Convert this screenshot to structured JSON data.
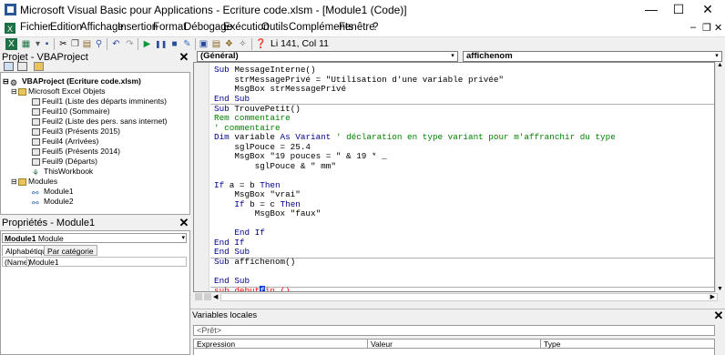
{
  "window": {
    "title": "Microsoft Visual Basic pour Applications - Ecriture code.xlsm - [Module1 (Code)]",
    "minimize": "—",
    "maximize": "☐",
    "close": "✕"
  },
  "menu": {
    "items": [
      "Fichier",
      "Edition",
      "Affichage",
      "Insertion",
      "Format",
      "Débogage",
      "Exécution",
      "Outils",
      "Compléments",
      "Fenêtre",
      "?"
    ],
    "mdi_minimize": "–",
    "mdi_restore": "❐",
    "mdi_close": "✕"
  },
  "toolbar": {
    "cursor_position": "Li 141, Col 11"
  },
  "project": {
    "title": "Projet - VBAProject",
    "root": "VBAProject (Ecriture code.xlsm)",
    "excel_objects": "Microsoft Excel Objets",
    "sheets": [
      "Feuil1 (Liste des départs imminents)",
      "Feuil10 (Sommaire)",
      "Feuil2 (Liste des pers. sans internet)",
      "Feuil3 (Présents 2015)",
      "Feuil4 (Arrivées)",
      "Feuil5 (Présents 2014)",
      "Feuil9 (Départs)",
      "ThisWorkbook"
    ],
    "modules_folder": "Modules",
    "modules": [
      "Module1",
      "Module2"
    ]
  },
  "properties": {
    "title": "Propriétés - Module1",
    "object_name": "Module1",
    "object_type": "Module",
    "tab_alpha": "Alphabétique",
    "tab_category": "Par catégorie",
    "row_name": "(Name)",
    "row_value": "Module1"
  },
  "code": {
    "object_combo": "(Général)",
    "proc_combo": "affichenom"
  },
  "locals": {
    "title": "Variables locales",
    "status": "<Prêt>",
    "col_expression": "Expression",
    "col_value": "Valeur",
    "col_type": "Type"
  },
  "colors": {
    "keyword": "#00008b",
    "comment": "#008000",
    "error": "#ff0000",
    "selection": "#0a3bd9"
  }
}
